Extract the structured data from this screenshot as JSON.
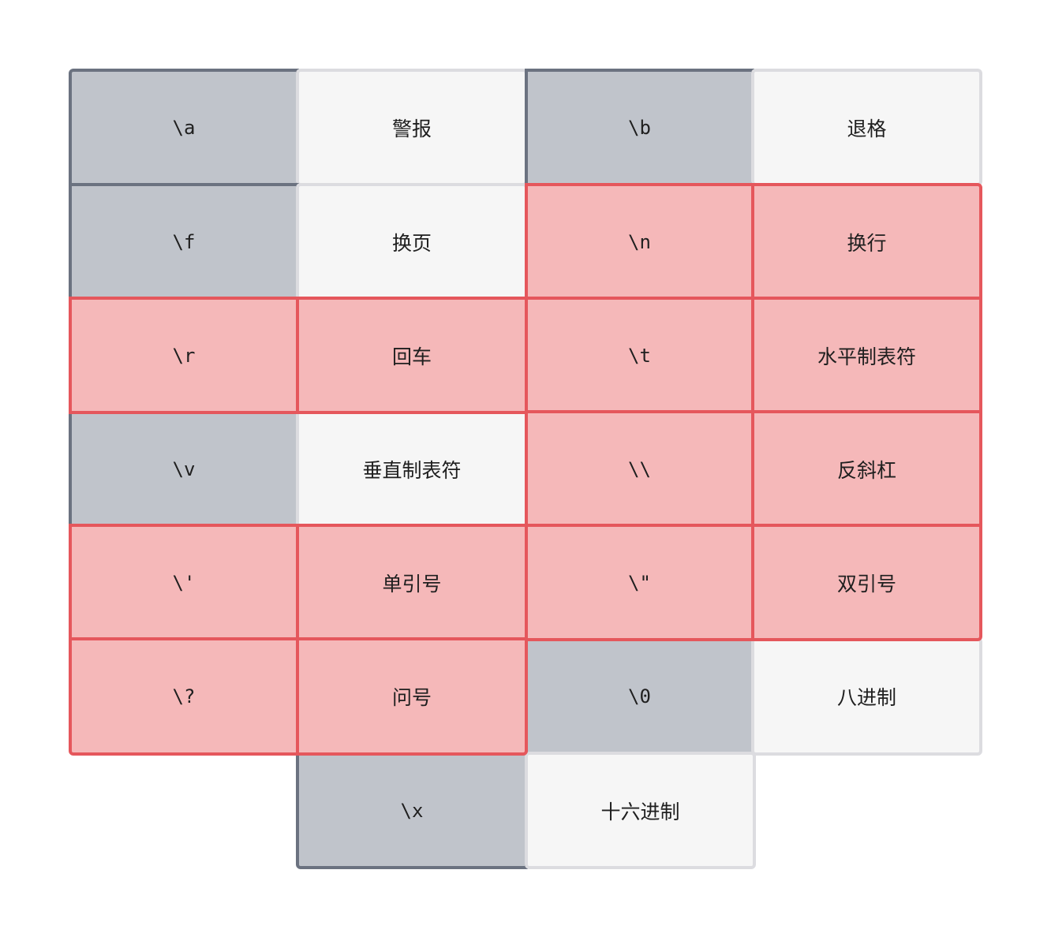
{
  "pairs": [
    {
      "code": "\\a",
      "name": "警报",
      "highlight": false
    },
    {
      "code": "\\b",
      "name": "退格",
      "highlight": false
    },
    {
      "code": "\\f",
      "name": "换页",
      "highlight": false
    },
    {
      "code": "\\n",
      "name": "换行",
      "highlight": true
    },
    {
      "code": "\\r",
      "name": "回车",
      "highlight": true
    },
    {
      "code": "\\t",
      "name": "水平制表符",
      "highlight": true
    },
    {
      "code": "\\v",
      "name": "垂直制表符",
      "highlight": false
    },
    {
      "code": "\\\\",
      "name": "反斜杠",
      "highlight": true
    },
    {
      "code": "\\'",
      "name": "单引号",
      "highlight": true
    },
    {
      "code": "\\\"",
      "name": "双引号",
      "highlight": true
    },
    {
      "code": "\\?",
      "name": "问号",
      "highlight": true
    },
    {
      "code": "\\0",
      "name": "八进制",
      "highlight": false
    },
    {
      "code": "\\x",
      "name": "十六进制",
      "highlight": false
    }
  ],
  "colors": {
    "code_fill": "#c0c4cb",
    "code_border": "#6b7280",
    "name_fill": "#f6f6f6",
    "name_border": "#dcdce0",
    "highlight_fill": "#f5b8b9",
    "highlight_border": "#e5575c"
  }
}
